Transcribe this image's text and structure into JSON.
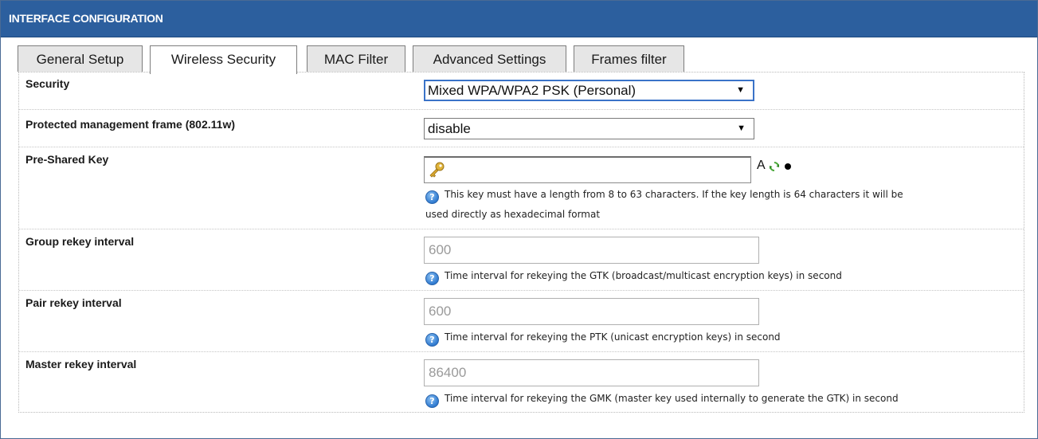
{
  "header": {
    "title": "INTERFACE CONFIGURATION"
  },
  "tabs": [
    {
      "label": "General Setup",
      "active": false
    },
    {
      "label": "Wireless Security",
      "active": true
    },
    {
      "label": "MAC Filter",
      "active": false
    },
    {
      "label": "Advanced Settings",
      "active": false
    },
    {
      "label": "Frames filter",
      "active": false
    }
  ],
  "form": {
    "security": {
      "label": "Security",
      "value": "Mixed WPA/WPA2 PSK (Personal)"
    },
    "pmf": {
      "label": "Protected management frame (802.11w)",
      "value": "disable"
    },
    "psk": {
      "label": "Pre-Shared Key",
      "value": "",
      "tool_letter": "A",
      "help_line1": "This key must have a length from 8 to 63 characters. If the key length is 64 characters it will be",
      "help_line2": "used directly as hexadecimal format"
    },
    "group_rekey": {
      "label": "Group rekey interval",
      "value": "600",
      "help": "Time interval for rekeying the GTK (broadcast/multicast encryption keys) in second"
    },
    "pair_rekey": {
      "label": "Pair rekey interval",
      "value": "600",
      "help": "Time interval for rekeying the PTK (unicast encryption keys) in second"
    },
    "master_rekey": {
      "label": "Master rekey interval",
      "value": "86400",
      "help": "Time interval for rekeying the GMK (master key used internally to generate the GTK) in second"
    }
  },
  "icons": {
    "help": "help-icon",
    "key": "key-icon",
    "refresh": "refresh-icon",
    "dropdown": "chevron-down-icon"
  },
  "colors": {
    "header_bg": "#2c5f9e",
    "help_icon": "#2f7ad0"
  }
}
